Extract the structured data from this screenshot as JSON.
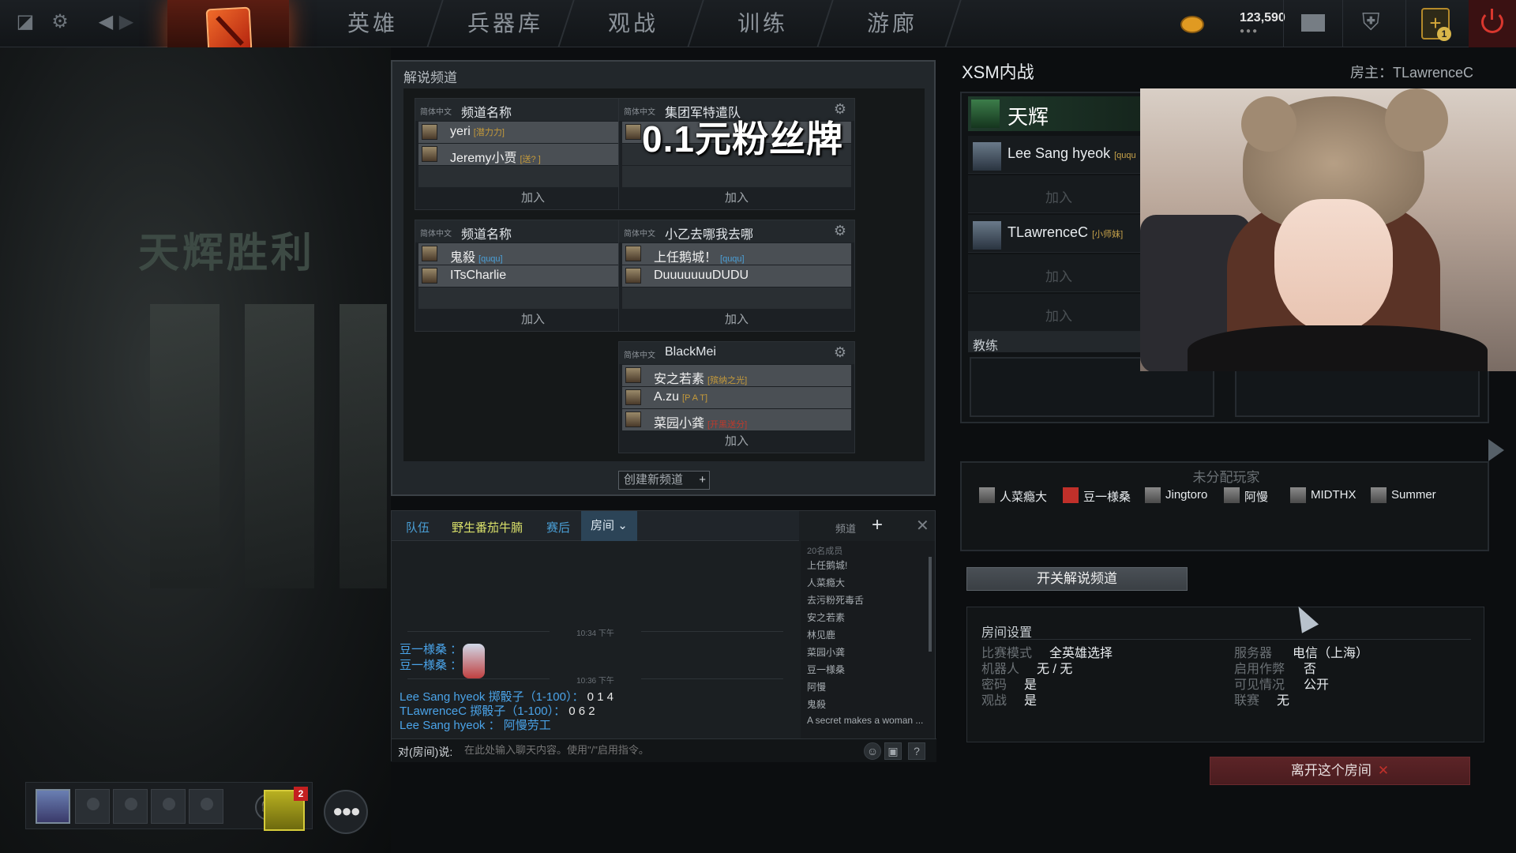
{
  "nav": {
    "items": [
      "英雄",
      "兵器库",
      "观战",
      "训练",
      "游廊"
    ],
    "gold": "123,590",
    "plus_badge": "1"
  },
  "background": {
    "victory_text": "天辉胜利"
  },
  "party": {
    "mic_badge": "2"
  },
  "broadcast": {
    "title": "解说频道",
    "overlay": "0.1元粉丝牌",
    "create_label": "创建新频道",
    "channels": [
      {
        "lang": "简体中文",
        "name": "频道名称",
        "players": [
          {
            "name": "yeri",
            "tag": "[潜力力]"
          },
          {
            "name": "Jeremy小贾",
            "tag": "[送? ]"
          }
        ],
        "join": "加入"
      },
      {
        "lang": "简体中文",
        "name": "集团军特遣队",
        "players": [],
        "join": "加入"
      },
      {
        "lang": "简体中文",
        "name": "频道名称",
        "players": [
          {
            "name": "鬼殺",
            "tag": "[ququ]"
          },
          {
            "name": "ITsCharlie",
            "tag": ""
          }
        ],
        "join": "加入"
      },
      {
        "lang": "简体中文",
        "name": "小乙去哪我去哪",
        "players": [
          {
            "name": "上任鹅城！",
            "tag": "[ququ]"
          },
          {
            "name": "DuuuuuuuDUDU",
            "tag": ""
          }
        ],
        "join": "加入"
      },
      {
        "lang": "简体中文",
        "name": "BlackMei",
        "players": [
          {
            "name": "安之若素",
            "tag": "[殡纳之光]"
          },
          {
            "name": "A.zu",
            "tag": "[P A T]"
          },
          {
            "name": "菜园小龚",
            "tag": "[开黑送分]"
          }
        ],
        "join": "加入"
      }
    ]
  },
  "chat": {
    "tabs": [
      "队伍",
      "野生番茄牛腩",
      "赛后",
      "房间"
    ],
    "channel_label": "频道",
    "timestamp1": "10:34 下午",
    "timestamp2": "10:36 下午",
    "msg1_sender": "豆一様桑 ：",
    "msg2_sender": "豆一様桑 ：",
    "roll1_text": "Lee Sang hyeok 掷骰子（1-100）：",
    "roll1_val": "0 1 4",
    "roll2_text": "TLawrenceC 掷骰子（1-100）：",
    "roll2_val": "0 6 2",
    "msg3_text": "Lee Sang hyeok ： 阿慢劳工",
    "input_label": "对(房间)说:",
    "input_placeholder": "在此处输入聊天内容。使用\"/\"启用指令。",
    "member_count": "20名成员",
    "members": [
      "上任鹅城!",
      "人菜瘾大",
      "去污粉死毒舌",
      "安之若素",
      "林见鹿",
      "菜园小龚",
      "豆一様桑",
      "阿慢",
      "鬼殺",
      "A secret makes a woman ..."
    ]
  },
  "lobby": {
    "title": "XSM内战",
    "host": "房主：TLawrenceC",
    "radiant": "天辉",
    "slots": [
      {
        "name": "Lee Sang hyeok",
        "tag": "[ququ"
      },
      {
        "join": "加入"
      },
      {
        "name": "TLawrenceC",
        "tag": "[小师妹]"
      },
      {
        "join": "加入"
      },
      {
        "join": "加入"
      }
    ],
    "coach": "教练",
    "unassigned_title": "未分配玩家",
    "unassigned": [
      "人菜瘾大",
      "豆一様桑",
      "Jingtoro",
      "阿慢",
      "MIDTHX",
      "Summer"
    ],
    "toggle_label": "开关解说频道",
    "leave_label": "离开这个房间",
    "settings": {
      "title": "房间设置",
      "left": [
        {
          "k": "比赛模式",
          "v": "全英雄选择"
        },
        {
          "k": "机器人",
          "v": "无 / 无"
        },
        {
          "k": "密码",
          "v": "是"
        },
        {
          "k": "观战",
          "v": "是"
        }
      ],
      "right": [
        {
          "k": "服务器",
          "v": "电信（上海）"
        },
        {
          "k": "启用作弊",
          "v": "否"
        },
        {
          "k": "可见情况",
          "v": "公开"
        },
        {
          "k": "联赛",
          "v": "无"
        }
      ]
    }
  }
}
